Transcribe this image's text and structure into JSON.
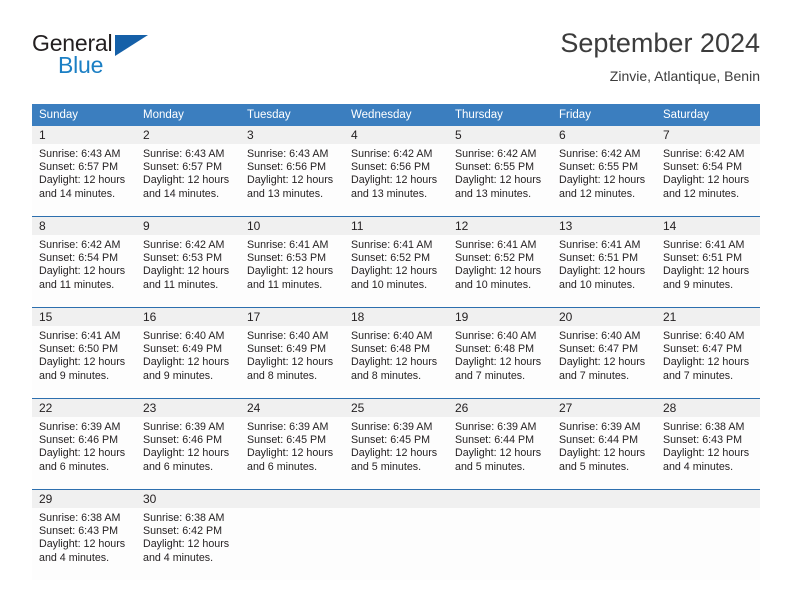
{
  "brand": {
    "name_top": "General",
    "name_bottom": "Blue",
    "triangle_color": "#1560a8",
    "blue_text_color": "#1b7fc4"
  },
  "header": {
    "title": "September 2024",
    "subtitle": "Zinvie, Atlantique, Benin"
  },
  "theme": {
    "header_blue": "#3b7ebf",
    "rule_blue": "#2d6fae",
    "date_band": "#f0f0f0"
  },
  "weekday_headers": [
    "Sunday",
    "Monday",
    "Tuesday",
    "Wednesday",
    "Thursday",
    "Friday",
    "Saturday"
  ],
  "weeks": [
    [
      {
        "day": "1",
        "sunrise": "Sunrise: 6:43 AM",
        "sunset": "Sunset: 6:57 PM",
        "daylight1": "Daylight: 12 hours",
        "daylight2": "and 14 minutes."
      },
      {
        "day": "2",
        "sunrise": "Sunrise: 6:43 AM",
        "sunset": "Sunset: 6:57 PM",
        "daylight1": "Daylight: 12 hours",
        "daylight2": "and 14 minutes."
      },
      {
        "day": "3",
        "sunrise": "Sunrise: 6:43 AM",
        "sunset": "Sunset: 6:56 PM",
        "daylight1": "Daylight: 12 hours",
        "daylight2": "and 13 minutes."
      },
      {
        "day": "4",
        "sunrise": "Sunrise: 6:42 AM",
        "sunset": "Sunset: 6:56 PM",
        "daylight1": "Daylight: 12 hours",
        "daylight2": "and 13 minutes."
      },
      {
        "day": "5",
        "sunrise": "Sunrise: 6:42 AM",
        "sunset": "Sunset: 6:55 PM",
        "daylight1": "Daylight: 12 hours",
        "daylight2": "and 13 minutes."
      },
      {
        "day": "6",
        "sunrise": "Sunrise: 6:42 AM",
        "sunset": "Sunset: 6:55 PM",
        "daylight1": "Daylight: 12 hours",
        "daylight2": "and 12 minutes."
      },
      {
        "day": "7",
        "sunrise": "Sunrise: 6:42 AM",
        "sunset": "Sunset: 6:54 PM",
        "daylight1": "Daylight: 12 hours",
        "daylight2": "and 12 minutes."
      }
    ],
    [
      {
        "day": "8",
        "sunrise": "Sunrise: 6:42 AM",
        "sunset": "Sunset: 6:54 PM",
        "daylight1": "Daylight: 12 hours",
        "daylight2": "and 11 minutes."
      },
      {
        "day": "9",
        "sunrise": "Sunrise: 6:42 AM",
        "sunset": "Sunset: 6:53 PM",
        "daylight1": "Daylight: 12 hours",
        "daylight2": "and 11 minutes."
      },
      {
        "day": "10",
        "sunrise": "Sunrise: 6:41 AM",
        "sunset": "Sunset: 6:53 PM",
        "daylight1": "Daylight: 12 hours",
        "daylight2": "and 11 minutes."
      },
      {
        "day": "11",
        "sunrise": "Sunrise: 6:41 AM",
        "sunset": "Sunset: 6:52 PM",
        "daylight1": "Daylight: 12 hours",
        "daylight2": "and 10 minutes."
      },
      {
        "day": "12",
        "sunrise": "Sunrise: 6:41 AM",
        "sunset": "Sunset: 6:52 PM",
        "daylight1": "Daylight: 12 hours",
        "daylight2": "and 10 minutes."
      },
      {
        "day": "13",
        "sunrise": "Sunrise: 6:41 AM",
        "sunset": "Sunset: 6:51 PM",
        "daylight1": "Daylight: 12 hours",
        "daylight2": "and 10 minutes."
      },
      {
        "day": "14",
        "sunrise": "Sunrise: 6:41 AM",
        "sunset": "Sunset: 6:51 PM",
        "daylight1": "Daylight: 12 hours",
        "daylight2": "and 9 minutes."
      }
    ],
    [
      {
        "day": "15",
        "sunrise": "Sunrise: 6:41 AM",
        "sunset": "Sunset: 6:50 PM",
        "daylight1": "Daylight: 12 hours",
        "daylight2": "and 9 minutes."
      },
      {
        "day": "16",
        "sunrise": "Sunrise: 6:40 AM",
        "sunset": "Sunset: 6:49 PM",
        "daylight1": "Daylight: 12 hours",
        "daylight2": "and 9 minutes."
      },
      {
        "day": "17",
        "sunrise": "Sunrise: 6:40 AM",
        "sunset": "Sunset: 6:49 PM",
        "daylight1": "Daylight: 12 hours",
        "daylight2": "and 8 minutes."
      },
      {
        "day": "18",
        "sunrise": "Sunrise: 6:40 AM",
        "sunset": "Sunset: 6:48 PM",
        "daylight1": "Daylight: 12 hours",
        "daylight2": "and 8 minutes."
      },
      {
        "day": "19",
        "sunrise": "Sunrise: 6:40 AM",
        "sunset": "Sunset: 6:48 PM",
        "daylight1": "Daylight: 12 hours",
        "daylight2": "and 7 minutes."
      },
      {
        "day": "20",
        "sunrise": "Sunrise: 6:40 AM",
        "sunset": "Sunset: 6:47 PM",
        "daylight1": "Daylight: 12 hours",
        "daylight2": "and 7 minutes."
      },
      {
        "day": "21",
        "sunrise": "Sunrise: 6:40 AM",
        "sunset": "Sunset: 6:47 PM",
        "daylight1": "Daylight: 12 hours",
        "daylight2": "and 7 minutes."
      }
    ],
    [
      {
        "day": "22",
        "sunrise": "Sunrise: 6:39 AM",
        "sunset": "Sunset: 6:46 PM",
        "daylight1": "Daylight: 12 hours",
        "daylight2": "and 6 minutes."
      },
      {
        "day": "23",
        "sunrise": "Sunrise: 6:39 AM",
        "sunset": "Sunset: 6:46 PM",
        "daylight1": "Daylight: 12 hours",
        "daylight2": "and 6 minutes."
      },
      {
        "day": "24",
        "sunrise": "Sunrise: 6:39 AM",
        "sunset": "Sunset: 6:45 PM",
        "daylight1": "Daylight: 12 hours",
        "daylight2": "and 6 minutes."
      },
      {
        "day": "25",
        "sunrise": "Sunrise: 6:39 AM",
        "sunset": "Sunset: 6:45 PM",
        "daylight1": "Daylight: 12 hours",
        "daylight2": "and 5 minutes."
      },
      {
        "day": "26",
        "sunrise": "Sunrise: 6:39 AM",
        "sunset": "Sunset: 6:44 PM",
        "daylight1": "Daylight: 12 hours",
        "daylight2": "and 5 minutes."
      },
      {
        "day": "27",
        "sunrise": "Sunrise: 6:39 AM",
        "sunset": "Sunset: 6:44 PM",
        "daylight1": "Daylight: 12 hours",
        "daylight2": "and 5 minutes."
      },
      {
        "day": "28",
        "sunrise": "Sunrise: 6:38 AM",
        "sunset": "Sunset: 6:43 PM",
        "daylight1": "Daylight: 12 hours",
        "daylight2": "and 4 minutes."
      }
    ],
    [
      {
        "day": "29",
        "sunrise": "Sunrise: 6:38 AM",
        "sunset": "Sunset: 6:43 PM",
        "daylight1": "Daylight: 12 hours",
        "daylight2": "and 4 minutes."
      },
      {
        "day": "30",
        "sunrise": "Sunrise: 6:38 AM",
        "sunset": "Sunset: 6:42 PM",
        "daylight1": "Daylight: 12 hours",
        "daylight2": "and 4 minutes."
      },
      {
        "day": "",
        "sunrise": "",
        "sunset": "",
        "daylight1": "",
        "daylight2": ""
      },
      {
        "day": "",
        "sunrise": "",
        "sunset": "",
        "daylight1": "",
        "daylight2": ""
      },
      {
        "day": "",
        "sunrise": "",
        "sunset": "",
        "daylight1": "",
        "daylight2": ""
      },
      {
        "day": "",
        "sunrise": "",
        "sunset": "",
        "daylight1": "",
        "daylight2": ""
      },
      {
        "day": "",
        "sunrise": "",
        "sunset": "",
        "daylight1": "",
        "daylight2": ""
      }
    ]
  ]
}
